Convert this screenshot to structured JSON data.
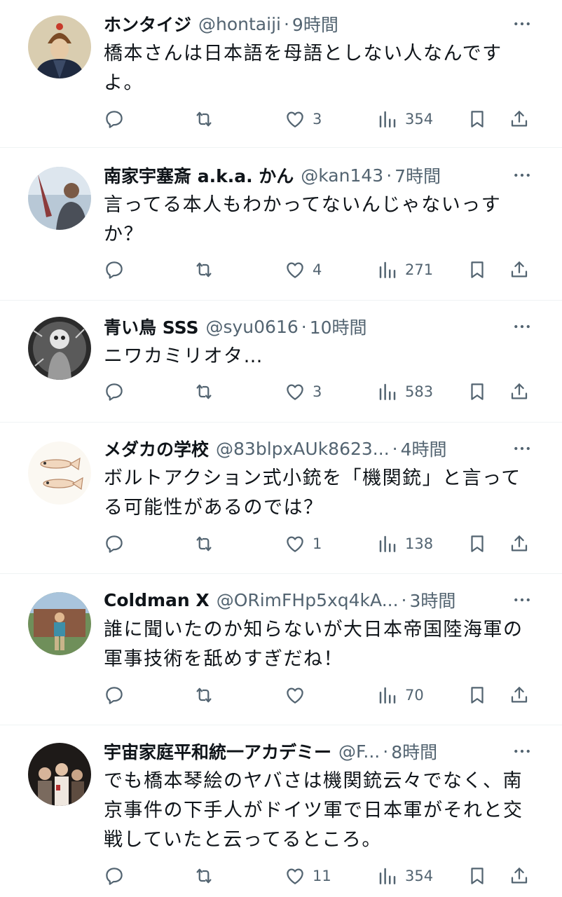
{
  "tweets": [
    {
      "name": "ホンタイジ",
      "handle": "@hontaiji",
      "dot": "·",
      "time": "9時間",
      "text": "橋本さんは日本語を母語としない人なんです\nよ。",
      "replies": "",
      "retweets": "",
      "likes": "3",
      "views": "354",
      "avatar": "portrait-qing-emperor"
    },
    {
      "name": "南家宇塞斎 a.k.a. かん",
      "handle": "@kan143",
      "dot": "·",
      "time": "7時間",
      "text": "言ってる本人もわかってないんじゃないっす\nか？",
      "replies": "",
      "retweets": "",
      "likes": "4",
      "views": "271",
      "avatar": "photo-sky"
    },
    {
      "name": "青い鳥 SSS",
      "handle": "@syu0616",
      "dot": "·",
      "time": "10時間",
      "text": "ニワカミリオタ…",
      "replies": "",
      "retweets": "",
      "likes": "3",
      "views": "583",
      "avatar": "photo-monochrome-figure"
    },
    {
      "name": "メダカの学校",
      "handle": "@83blpxAUk8623...",
      "dot": "·",
      "time": "4時間",
      "text": "ボルトアクション式小銃を「機関銃」と言って\nる可能性があるのでは？",
      "replies": "",
      "retweets": "",
      "likes": "1",
      "views": "138",
      "avatar": "medaka-fish-drawing"
    },
    {
      "name": "Coldman X",
      "handle": "@ORimFHp5xq4kA...",
      "dot": "·",
      "time": "3時間",
      "text": "誰に聞いたのか知らないが大日本帝国陸海軍の\n軍事技術を舐めすぎだね！",
      "replies": "",
      "retweets": "",
      "likes": "",
      "views": "70",
      "avatar": "photo-person-outdoors"
    },
    {
      "name": "宇宙家庭平和統一アカデミー",
      "handle": "@F...",
      "dot": "·",
      "time": "8時間",
      "text": "でも橋本琴絵のヤバさは機関銃云々でなく、南\n京事件の下手人がドイツ軍で日本軍がそれと交\n戦していたと云ってるところ。",
      "replies": "",
      "retweets": "",
      "likes": "11",
      "views": "354",
      "avatar": "photo-group-dark"
    }
  ],
  "icons": {
    "reply": "reply-icon",
    "retweet": "retweet-icon",
    "like": "heart-icon",
    "views": "views-chart-icon",
    "bookmark": "bookmark-icon",
    "share": "share-icon",
    "more": "more-dots-icon"
  },
  "colors": {
    "text": "#0f1419",
    "secondary": "#536471",
    "divider": "#eff3f4",
    "background": "#ffffff"
  }
}
